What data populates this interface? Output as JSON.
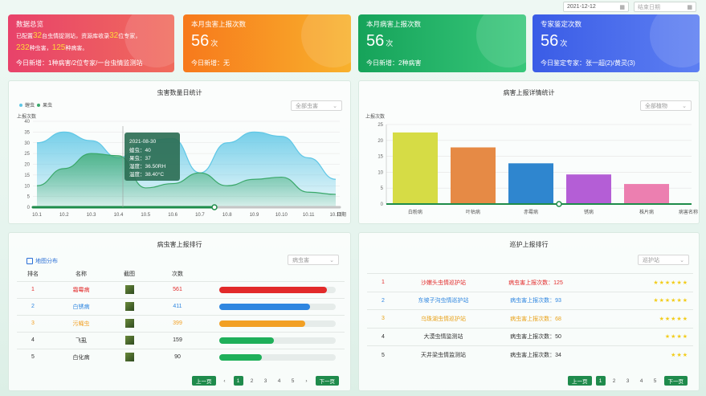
{
  "header": {
    "date": "2021-12-12",
    "end_placeholder": "结束日期"
  },
  "stats": {
    "overview": {
      "title": "数据总览",
      "line1_pre": "已配置",
      "line1_n1": "32",
      "line1_mid": "台虫情捉测站，资源库收录",
      "line1_n2": "32",
      "line1_post": "位专家，",
      "line2_n1": "232",
      "line2_mid": "种虫害，",
      "line2_n2": "125",
      "line2_post": "种病害。",
      "today": "今日新增：1种病害/2位专家/一台虫情监测站"
    },
    "pest": {
      "title": "本月虫害上报次数",
      "value": "56",
      "unit": "次",
      "sub": "今日新增：无"
    },
    "disease": {
      "title": "本月病害上报次数",
      "value": "56",
      "unit": "次",
      "sub": "今日新增：2种病害"
    },
    "expert": {
      "title": "专家鉴定次数",
      "value": "56",
      "unit": "次",
      "sub": "今日鉴定专家：张一超(2)/黄灵(3)"
    }
  },
  "pest_chart": {
    "title": "虫害数量日统计",
    "select": "全部虫害",
    "legend": [
      "蝗虫",
      "果虫"
    ],
    "ylabel": "上报次数",
    "yticks": [
      "0",
      "5",
      "10",
      "15",
      "20",
      "25",
      "30",
      "35",
      "40"
    ],
    "xticks": [
      "10.1",
      "10.2",
      "10.3",
      "10.4",
      "10.5",
      "10.6",
      "10.7",
      "10.8",
      "10.9",
      "10.10",
      "10.11",
      "10.12",
      "日期"
    ],
    "tooltip": [
      "2021-08-30",
      "蝗虫：40",
      "果虫：37",
      "湿度：36.50RH",
      "温度：38.40°C"
    ],
    "colors": {
      "series1": "#5fc7e6",
      "series2": "#3aa86a"
    }
  },
  "disease_chart": {
    "title": "病害上报详情统计",
    "select": "全部植物",
    "ylabel": "上报次数",
    "yticks": [
      "0",
      "5",
      "10",
      "15",
      "20",
      "25"
    ],
    "categories": [
      "白粉病",
      "叶枯病",
      "赤霉病",
      "锈病",
      "株片病"
    ],
    "xlabel": "病害名称",
    "values": [
      22.5,
      17.8,
      12.8,
      9.3,
      6.3
    ],
    "colors": [
      "#d6dc45",
      "#e68a45",
      "#2f86cf",
      "#b45ed6",
      "#ec7fb0"
    ]
  },
  "chart_data": [
    {
      "type": "area",
      "title": "虫害数量日统计",
      "ylabel": "上报次数",
      "ylim": [
        0,
        40
      ],
      "x": [
        "10.1",
        "10.2",
        "10.3",
        "10.4",
        "10.5",
        "10.6",
        "10.7",
        "10.8",
        "10.9",
        "10.10",
        "10.11",
        "10.12"
      ],
      "series": [
        {
          "name": "蝗虫",
          "values": [
            30,
            35,
            31,
            23,
            31,
            32,
            16,
            30,
            35,
            33,
            23,
            13
          ]
        },
        {
          "name": "果虫",
          "values": [
            10,
            18,
            25,
            24,
            9,
            11,
            16,
            10,
            13,
            14,
            7,
            6
          ]
        }
      ]
    },
    {
      "type": "bar",
      "title": "病害上报详情统计",
      "categories": [
        "白粉病",
        "叶枯病",
        "赤霉病",
        "锈病",
        "株片病"
      ],
      "values": [
        22.5,
        17.8,
        12.8,
        9.3,
        6.3
      ],
      "ylabel": "上报次数",
      "xlabel": "病害名称",
      "ylim": [
        0,
        25
      ]
    }
  ],
  "rank": {
    "title": "病虫害上报排行",
    "map_link": "地图分布",
    "select": "病虫害",
    "headers": [
      "排名",
      "名称",
      "截图",
      "次数"
    ],
    "rows": [
      {
        "rank": "1",
        "name": "霜霉病",
        "count": "561",
        "pct": 0.93,
        "color": "#e22a2a"
      },
      {
        "rank": "2",
        "name": "白锈病",
        "count": "411",
        "pct": 0.78,
        "color": "#2f86e0"
      },
      {
        "rank": "3",
        "name": "污蝇虫",
        "count": "399",
        "pct": 0.74,
        "color": "#f2a024"
      },
      {
        "rank": "4",
        "name": "飞虱",
        "count": "159",
        "pct": 0.47,
        "color": "#1fb05a"
      },
      {
        "rank": "5",
        "name": "白化病",
        "count": "90",
        "pct": 0.37,
        "color": "#1fb05a"
      }
    ],
    "pager": {
      "prev": "上一页",
      "next": "下一页",
      "pages": [
        "1",
        "2",
        "3",
        "4",
        "5"
      ]
    }
  },
  "patrol": {
    "title": "巡护上报排行",
    "select": "巡护站",
    "rows": [
      {
        "rank": "1",
        "name": "沙嫩头虫情巡护站",
        "label": "病虫害上报次数：125",
        "stars": 6,
        "color": "#e22a2a"
      },
      {
        "rank": "2",
        "name": "东坡子沟虫情巡护站",
        "label": "病虫害上报次数：93",
        "stars": 6,
        "color": "#2f86e0"
      },
      {
        "rank": "3",
        "name": "乌珠湖虫情巡护站",
        "label": "病虫害上报次数：68",
        "stars": 5,
        "color": "#e9a21a"
      },
      {
        "rank": "4",
        "name": "大漠虫情监测站",
        "label": "病虫害上报次数：50",
        "stars": 4,
        "color": "#333333"
      },
      {
        "rank": "5",
        "name": "天井梁虫情监测站",
        "label": "病虫害上报次数：34",
        "stars": 3,
        "color": "#333333"
      }
    ],
    "pager": {
      "prev": "上一页",
      "next": "下一页",
      "pages": [
        "1",
        "2",
        "3",
        "4",
        "5"
      ]
    }
  }
}
